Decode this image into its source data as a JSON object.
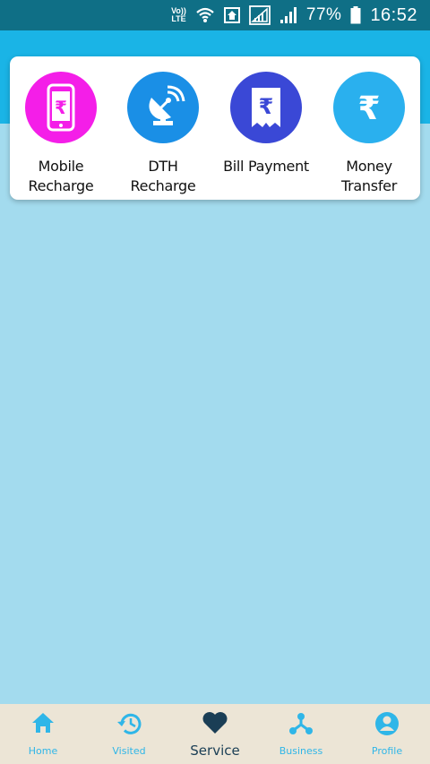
{
  "status_bar": {
    "volte_line1": "Vo))",
    "volte_line2": "LTE",
    "battery": "77%",
    "time": "16:52",
    "icons": [
      "wifi-icon",
      "home-signal-icon",
      "signal-icon",
      "signal-icon",
      "battery-icon"
    ]
  },
  "services": [
    {
      "label": "Mobile\nRecharge",
      "icon": "mobile-rupee-icon",
      "color": "#f41ee8"
    },
    {
      "label": "DTH\nRecharge",
      "icon": "satellite-dish-icon",
      "color": "#1a8fe6"
    },
    {
      "label": "Bill Payment",
      "icon": "receipt-rupee-icon",
      "color": "#3a48d6"
    },
    {
      "label": "Money\nTransfer",
      "icon": "rupee-icon",
      "color": "#2ab0ee"
    }
  ],
  "bottom_nav": [
    {
      "label": "Home",
      "icon": "home-icon"
    },
    {
      "label": "Visited",
      "icon": "history-icon"
    },
    {
      "label": "Service",
      "icon": "heart-icon",
      "active": true
    },
    {
      "label": "Business",
      "icon": "network-icon"
    },
    {
      "label": "Profile",
      "icon": "profile-icon"
    }
  ],
  "colors": {
    "status_bar": "#0f6f86",
    "header": "#1ab4e6",
    "background": "#a3dbee",
    "nav_background": "#ece5d6",
    "nav_accent": "#2fb6e8",
    "nav_active": "#1a3e55"
  }
}
